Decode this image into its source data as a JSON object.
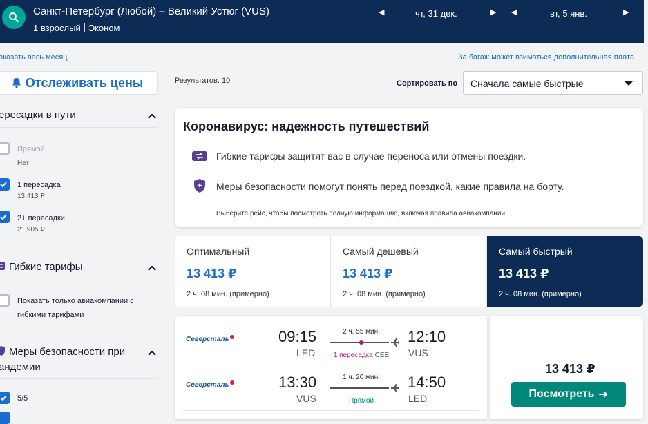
{
  "header": {
    "route": "Санкт-Петербург (Любой) – Великий Устюг (VUS)",
    "passengers": "1 взрослый",
    "cabin": "Эконом",
    "depart_date": "чт, 31 дек.",
    "return_date": "вт, 5 янв."
  },
  "links": {
    "whole_month": "оказать весь месяц",
    "baggage_note": "За багаж может взиматься дополнительная плата"
  },
  "sidebar": {
    "track_label": "Отслеживать цены",
    "stops_title": "ересадки в пути",
    "stops": [
      {
        "label": "Прямой",
        "sub": "Нет",
        "checked": false
      },
      {
        "label": "1 пересадка",
        "sub": "13 413 ₽",
        "checked": true
      },
      {
        "label": "2+ пересадки",
        "sub": "21 905 ₽",
        "checked": true
      }
    ],
    "flex_title": "Гибкие тарифы",
    "flex_option_line1": "Показать только авиакомпании с",
    "flex_option_line2": "гибкими тарифами",
    "safety_title_line1": "Меры безопасности при",
    "safety_title_line2": "андемии",
    "safety_option": "5/5"
  },
  "results": {
    "count_label": "Результатов: 10",
    "sort_label": "Сортировать по",
    "sort_value": "Сначала самые быстрые"
  },
  "covid": {
    "title": "Коронавирус: надежность путешествий",
    "line1": "Гибкие тарифы защитят вас в случае переноса или отмены поездки.",
    "line2": "Меры безопасности помогут понять перед поездкой, какие правила на борту.",
    "note": "Выберите рейс, чтобы посмотреть полную информацию, включая правила авиакомпании."
  },
  "tabs": [
    {
      "title": "Оптимальный",
      "price": "13 413 ₽",
      "duration": "2 ч. 08 мин. (примерно)",
      "active": false
    },
    {
      "title": "Самый дешевый",
      "price": "13 413 ₽",
      "duration": "2 ч. 08 мин. (примерно)",
      "active": false
    },
    {
      "title": "Самый быстрый",
      "price": "13 413 ₽",
      "duration": "2 ч. 08 мин. (примерно)",
      "active": true
    }
  ],
  "flight": {
    "outbound": {
      "airline": "Северсталь",
      "dep_time": "09:15",
      "dep_code": "LED",
      "arr_time": "12:10",
      "arr_code": "VUS",
      "duration": "2 ч. 55 мин.",
      "stops": "1 пересадка",
      "stop_code": "CEE"
    },
    "inbound": {
      "airline": "Северсталь",
      "dep_time": "13:30",
      "dep_code": "VUS",
      "arr_time": "14:50",
      "arr_code": "LED",
      "duration": "1 ч. 20 мин.",
      "stops": "Прямой"
    },
    "price": "13 413 ₽",
    "view_label": "Посмотреть"
  },
  "colors": {
    "header_bg": "#0c2b55",
    "accent": "#1a6dcc",
    "teal": "#00897b"
  }
}
